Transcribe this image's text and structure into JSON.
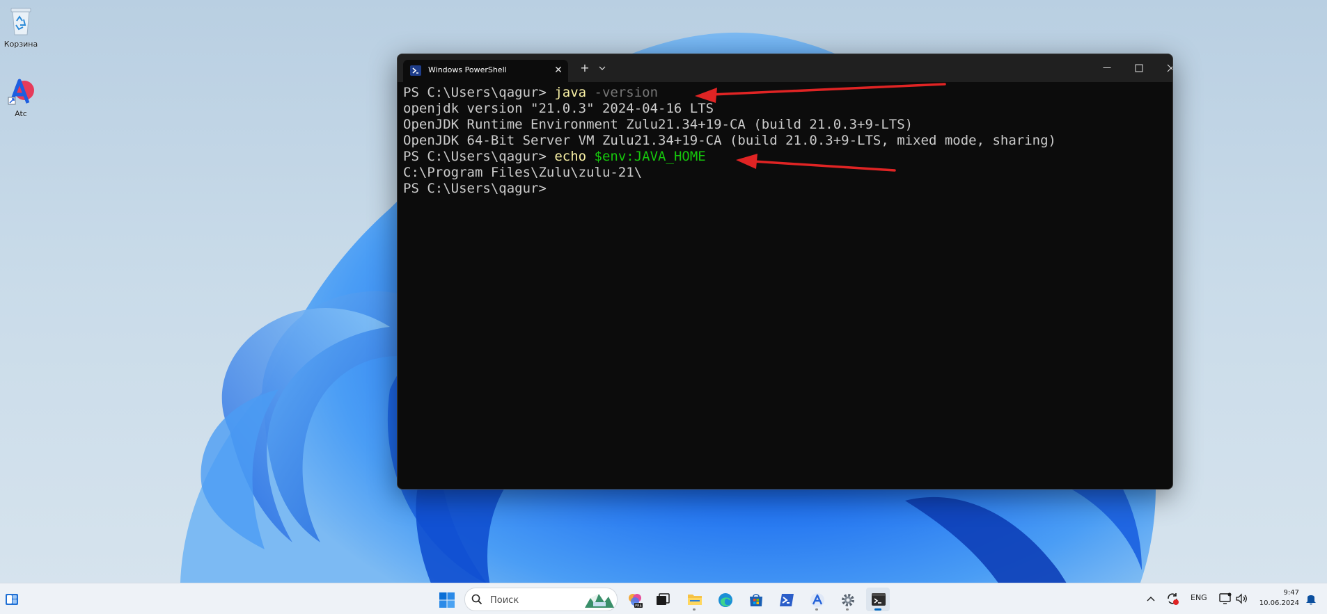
{
  "desktop": {
    "icons": [
      {
        "label": "Корзина"
      },
      {
        "label": "Atc"
      }
    ]
  },
  "terminal": {
    "tab_title": "Windows PowerShell",
    "new_tab_symbol": "+",
    "close_tab_symbol": "✕",
    "lines": {
      "l1_prompt": "PS C:\\Users\\qagur> ",
      "l1_cmd": "java",
      "l1_param": " -version",
      "l2": "openjdk version \"21.0.3\" 2024-04-16 LTS",
      "l3": "OpenJDK Runtime Environment Zulu21.34+19-CA (build 21.0.3+9-LTS)",
      "l4": "OpenJDK 64-Bit Server VM Zulu21.34+19-CA (build 21.0.3+9-LTS, mixed mode, sharing)",
      "l5_prompt": "PS C:\\Users\\qagur> ",
      "l5_cmd": "echo",
      "l5_var": " $env:JAVA_HOME",
      "l6": "C:\\Program Files\\Zulu\\zulu-21\\",
      "l7_prompt": "PS C:\\Users\\qagur>"
    },
    "colors": {
      "background": "#0c0c0c",
      "text": "#cccccc",
      "command": "#f9f1a5",
      "parameter": "#767676",
      "variable": "#16c60c"
    }
  },
  "annotations": {
    "arrow_color": "#e02424"
  },
  "taskbar": {
    "search_placeholder": "Поиск",
    "apps": [
      "widgets-icon",
      "start-icon",
      "copilot-icon",
      "task-view-icon",
      "file-explorer-icon",
      "edge-icon",
      "store-icon",
      "powershell-icon",
      "atc-icon",
      "settings-icon",
      "terminal-icon"
    ],
    "tray": {
      "language": "ENG",
      "time": "9:47",
      "date": "10.06.2024"
    }
  }
}
